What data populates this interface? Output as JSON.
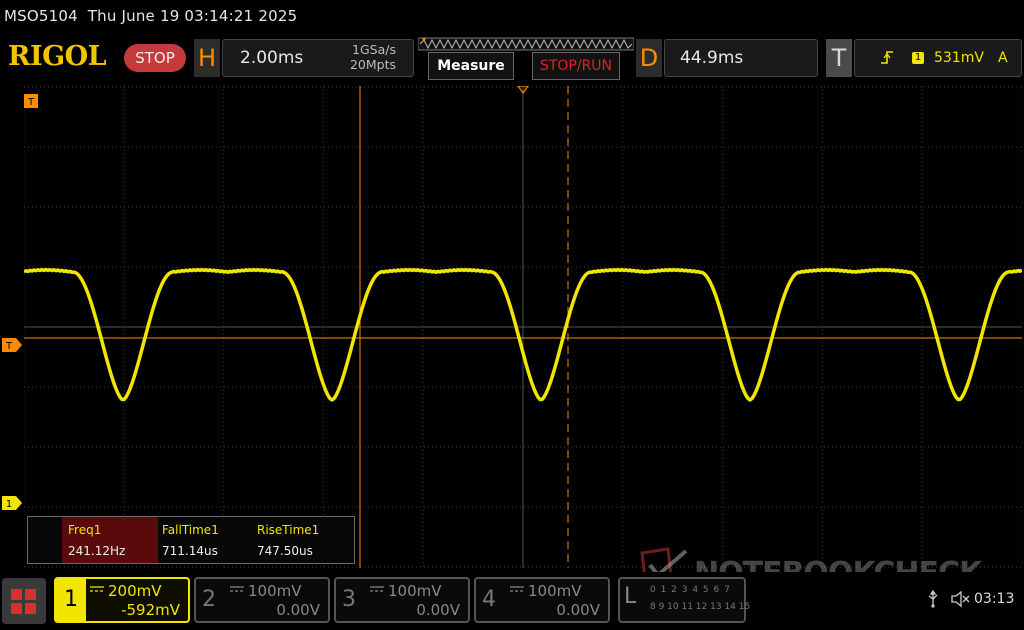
{
  "title_bar": {
    "text": "MSO5104  Thu June 19 03:14:21 2025"
  },
  "brand": {
    "logo": "RIGOL",
    "run_state": "STOP"
  },
  "horizontal": {
    "letter": "H",
    "timebase": "2.00ms",
    "sample_rate": "1GSa/s",
    "memory_depth": "20Mpts"
  },
  "buttons": {
    "measure": "Measure",
    "stop_run": "STOP/RUN"
  },
  "delay": {
    "letter": "D",
    "value": "44.9ms"
  },
  "trigger": {
    "letter": "T",
    "channel": "1",
    "level": "531mV",
    "mode": "A"
  },
  "markers": {
    "trigger_top": "T",
    "trigger_level": "T",
    "channel1_ground": "1"
  },
  "measurements": [
    {
      "name": "Freq1",
      "value": "241.12Hz"
    },
    {
      "name": "FallTime1",
      "value": "711.14us"
    },
    {
      "name": "RiseTime1",
      "value": "747.50us"
    }
  ],
  "watermark": "NOTEBOOKCHECK",
  "channels": [
    {
      "num": "1",
      "scale": "200mV",
      "offset": "-592mV",
      "active": true
    },
    {
      "num": "2",
      "scale": "100mV",
      "offset": "0.00V",
      "active": false
    },
    {
      "num": "3",
      "scale": "100mV",
      "offset": "0.00V",
      "active": false
    },
    {
      "num": "4",
      "scale": "100mV",
      "offset": "0.00V",
      "active": false
    }
  ],
  "logic_analyzer": {
    "letter": "L",
    "row1": "0 1 2 3 4 5 6 7",
    "row2": "8 9 10 11 12 13 14 15"
  },
  "status": {
    "clock": "03:13"
  },
  "colors": {
    "channel1": "#f2e600",
    "accent_orange": "#ff8c00",
    "stop_red": "#c53a3a",
    "grid": "#3a3a3a"
  },
  "icons": {
    "usb": "usb-icon",
    "speaker": "speaker-muted-icon",
    "menu": "menu-grid-icon"
  }
}
